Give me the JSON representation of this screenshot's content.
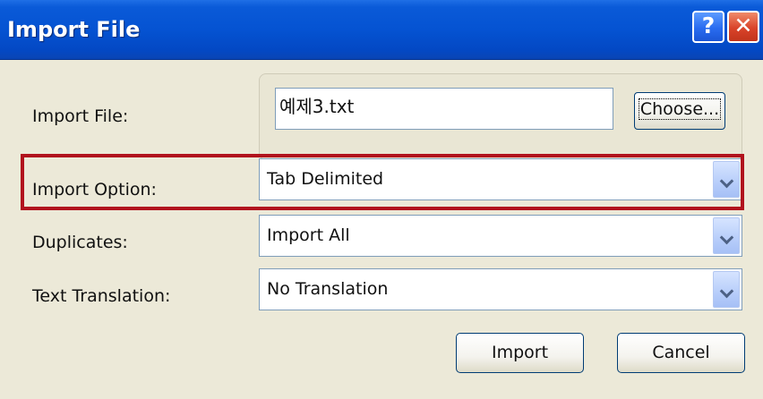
{
  "window": {
    "title": "Import File",
    "help_label": "?",
    "close_label": "✕"
  },
  "form": {
    "import_file": {
      "label": "Import File:",
      "value": "예제3.txt",
      "choose_label": "Choose..."
    },
    "import_option": {
      "label": "Import Option:",
      "selected": "Tab Delimited"
    },
    "duplicates": {
      "label": "Duplicates:",
      "selected": "Import All"
    },
    "text_translation": {
      "label": "Text Translation:",
      "selected": "No Translation"
    }
  },
  "buttons": {
    "import_label": "Import",
    "cancel_label": "Cancel"
  },
  "colors": {
    "titlebar": "#0553d2",
    "highlight": "#b1121d"
  }
}
